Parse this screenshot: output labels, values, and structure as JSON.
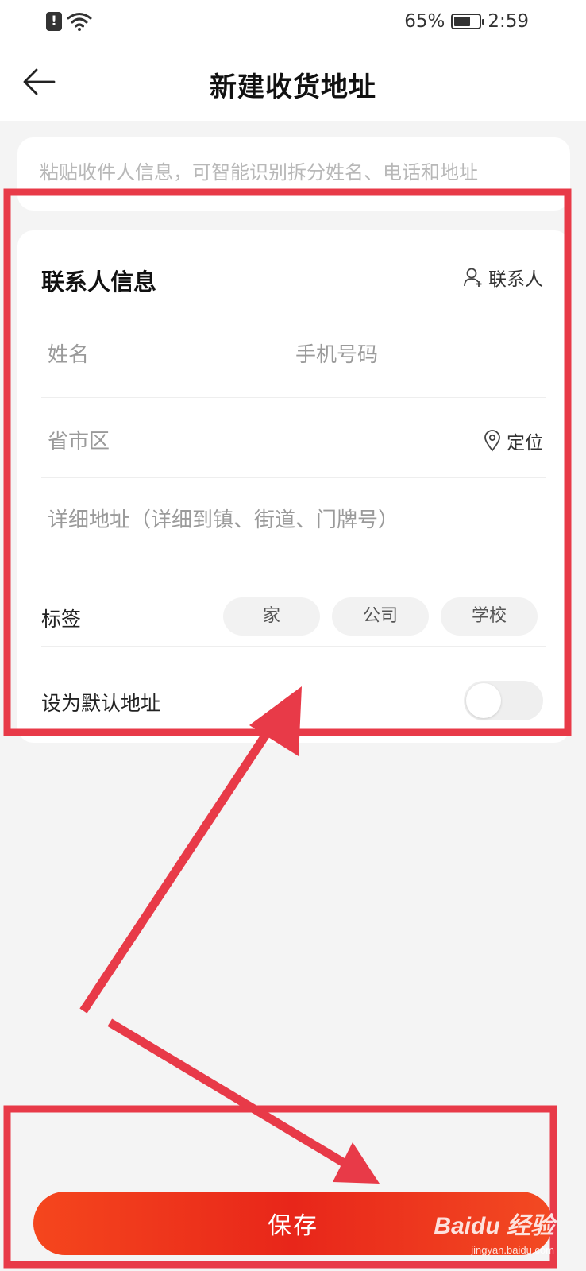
{
  "status_bar": {
    "alert_glyph": "!",
    "battery_percent": "65%",
    "battery_level": 0.65,
    "time": "2:59"
  },
  "header": {
    "title": "新建收货地址"
  },
  "paste_box": {
    "placeholder": "粘贴收件人信息，可智能识别拆分姓名、电话和地址"
  },
  "contact_card": {
    "title": "联系人信息",
    "contacts_link": "联系人",
    "name_placeholder": "姓名",
    "phone_placeholder": "手机号码",
    "region_placeholder": "省市区",
    "locate_link": "定位",
    "detail_placeholder": "详细地址（详细到镇、街道、门牌号）",
    "tags_label": "标签",
    "tags": [
      "家",
      "公司",
      "学校"
    ],
    "default_label": "设为默认地址",
    "default_on": false
  },
  "save_button": "保存",
  "watermark": {
    "brand": "Baidu 经验",
    "url": "jingyan.baidu.com"
  },
  "colors": {
    "annotation_red": "#e83a48",
    "button_red": "#e8261a",
    "background": "#f4f4f4"
  }
}
